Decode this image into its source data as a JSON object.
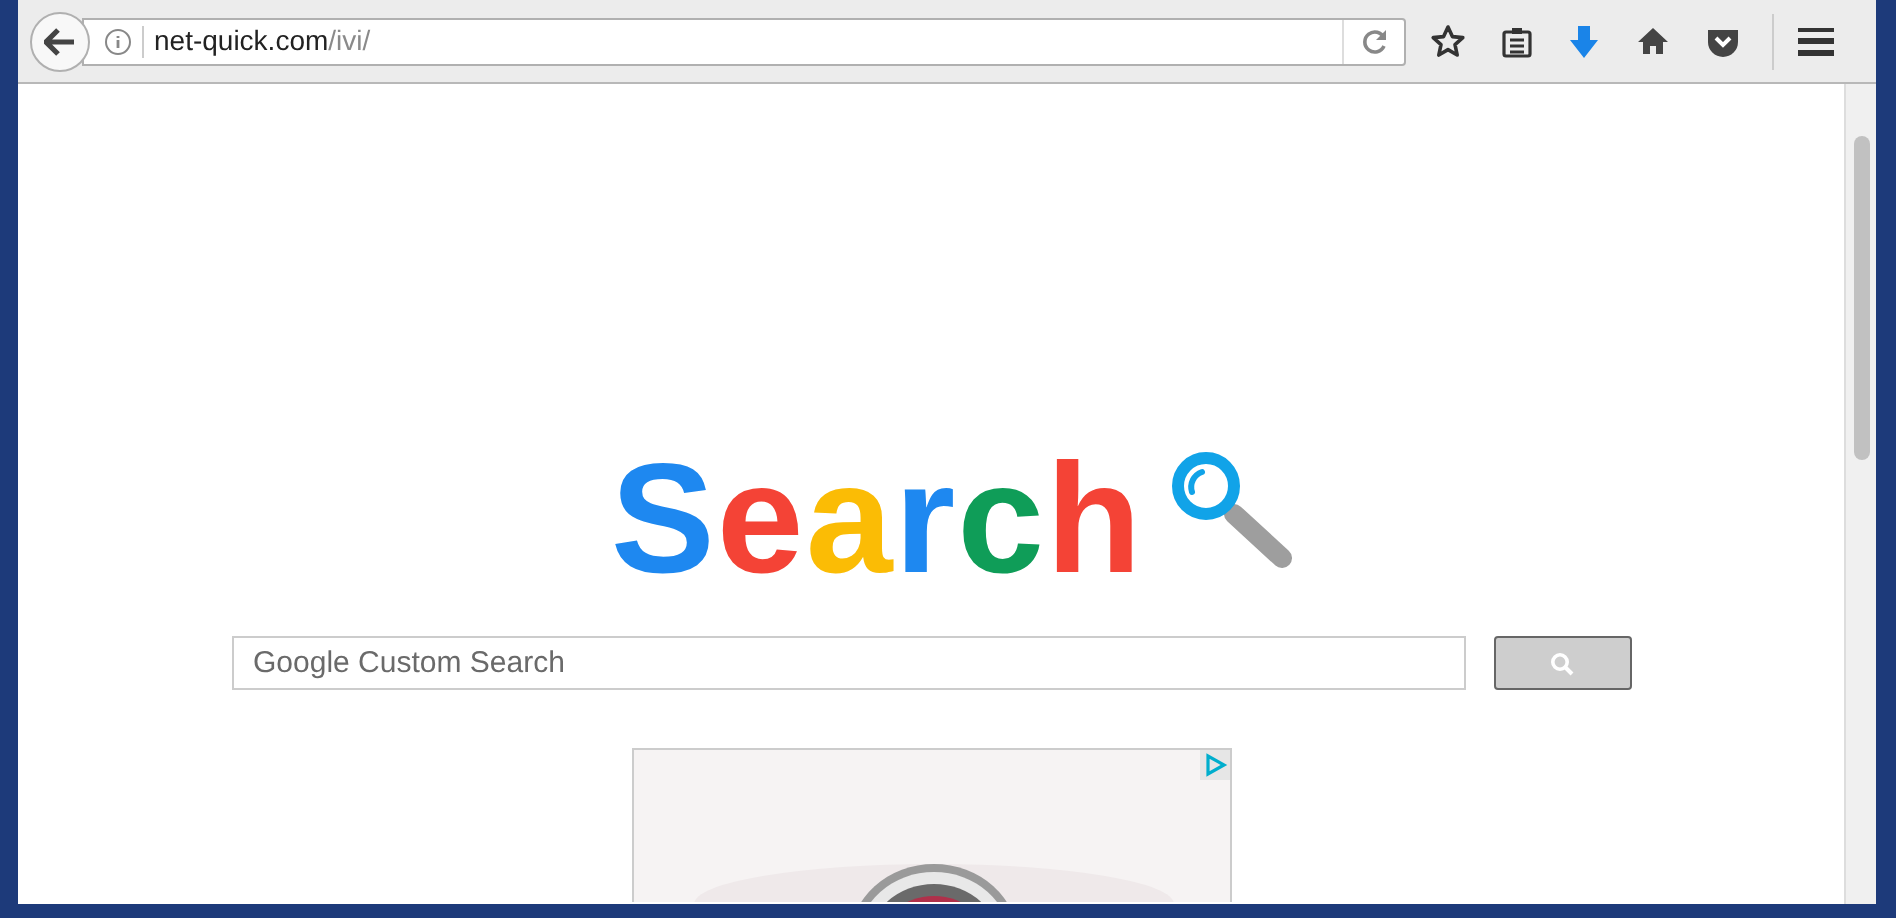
{
  "browser": {
    "url": {
      "host": "net-quick.com",
      "path": "/ivi/"
    }
  },
  "logo": {
    "letters": [
      {
        "text": "S",
        "color": "#1e88f0"
      },
      {
        "text": "e",
        "color": "#f44336"
      },
      {
        "text": "a",
        "color": "#fbbc05"
      },
      {
        "text": "r",
        "color": "#1e88f0"
      },
      {
        "text": "c",
        "color": "#0f9d58"
      },
      {
        "text": "h",
        "color": "#f44336"
      }
    ]
  },
  "search": {
    "placeholder": "Google Custom Search"
  }
}
